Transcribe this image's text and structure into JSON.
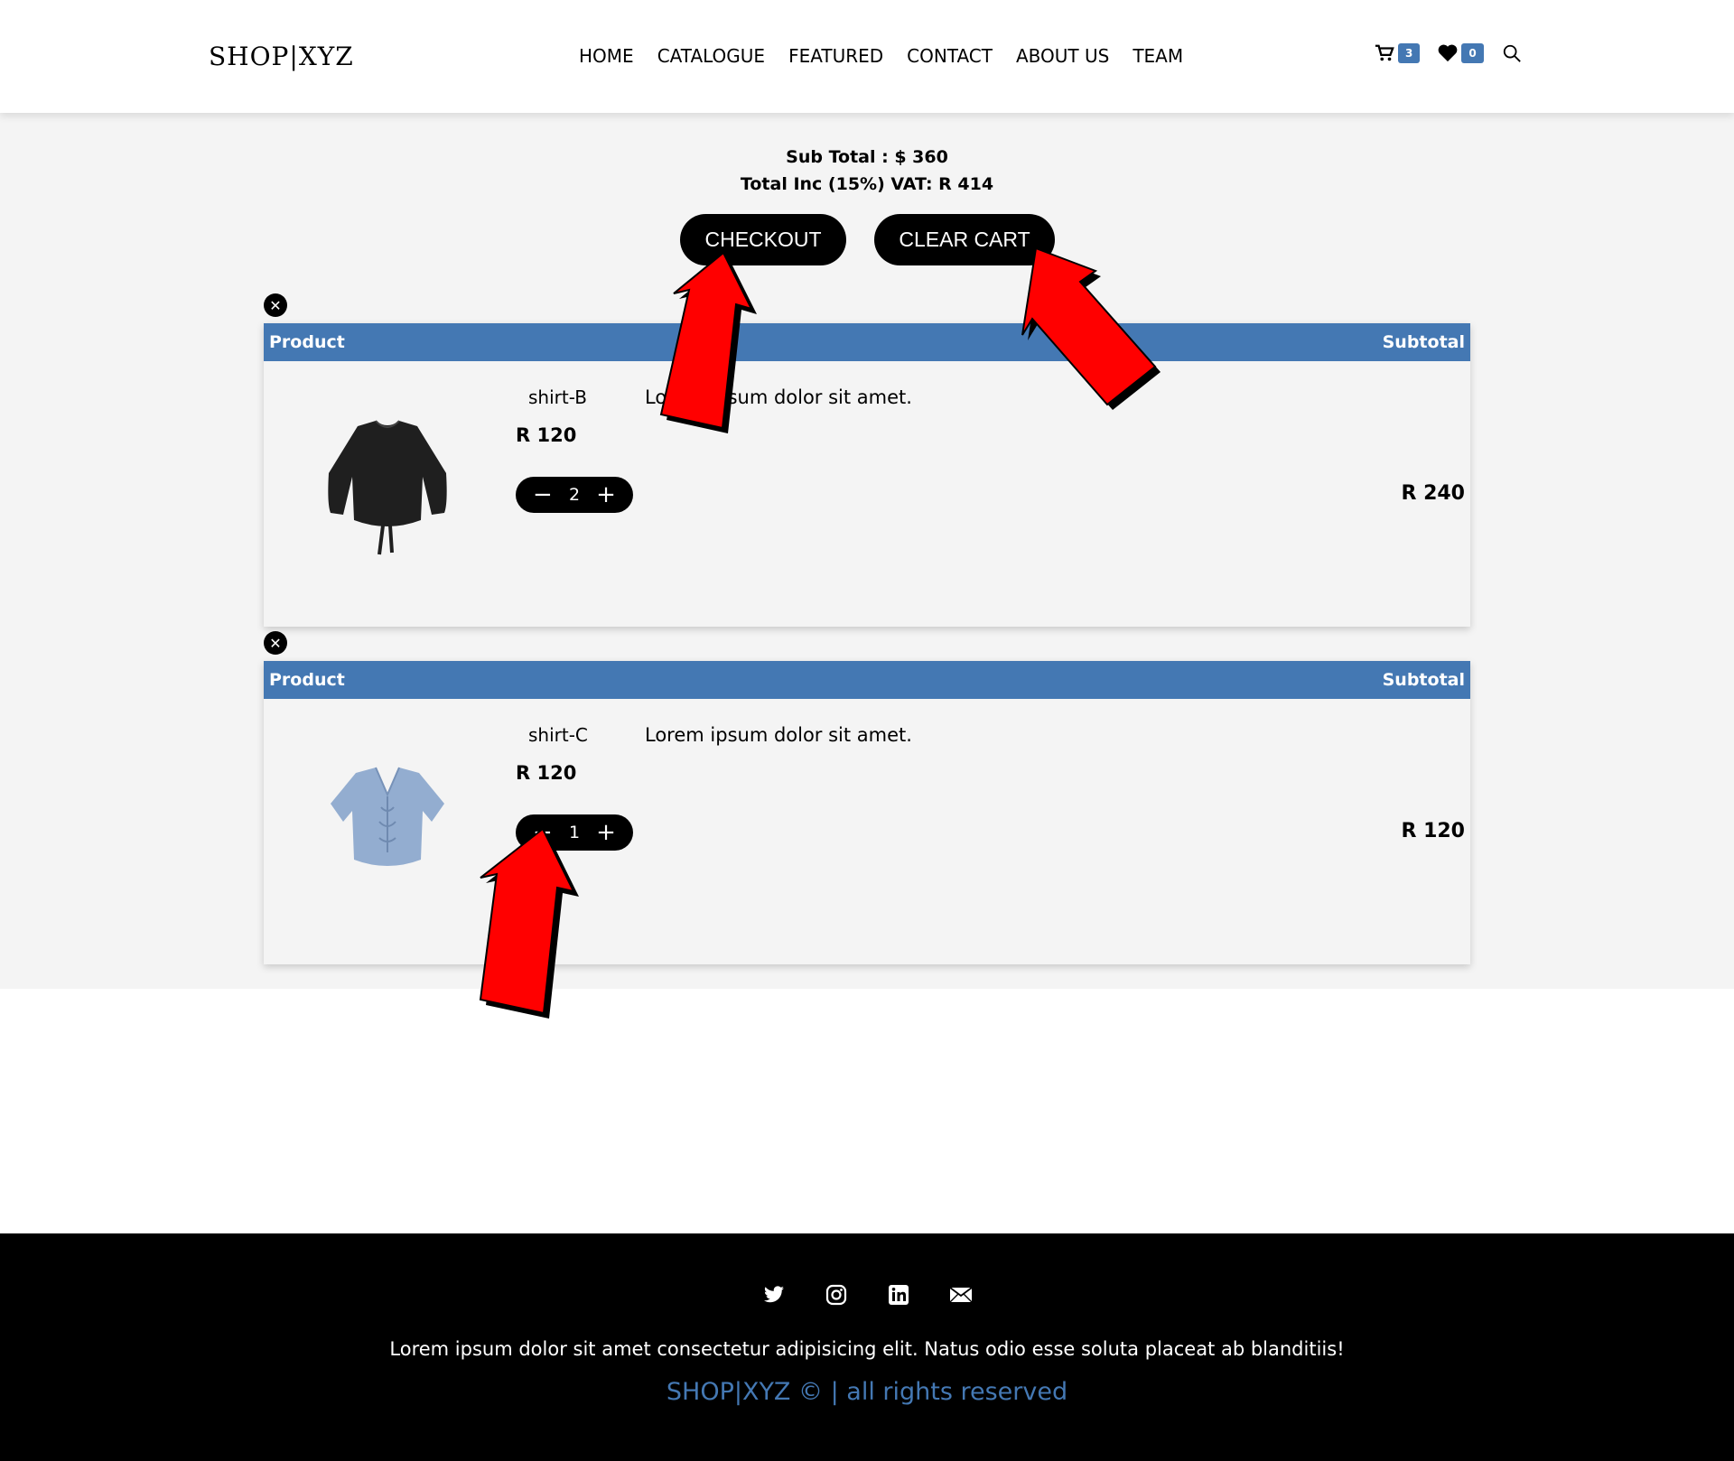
{
  "header": {
    "logo": "SHOP|XYZ",
    "nav": [
      "HOME",
      "CATALOGUE",
      "FEATURED",
      "CONTACT",
      "ABOUT US",
      "TEAM"
    ],
    "cart_count": "3",
    "wishlist_count": "0"
  },
  "summary": {
    "subtotal": "Sub Total : $ 360",
    "total_vat": "Total Inc (15%) VAT: R 414",
    "checkout_label": "CHECKOUT",
    "clear_label": "CLEAR CART"
  },
  "table": {
    "product_header": "Product",
    "subtotal_header": "Subtotal"
  },
  "items": [
    {
      "name": "shirt-B",
      "description": "Lorem ipsum dolor sit amet.",
      "price": "R 120",
      "quantity": "2",
      "subtotal": "R 240",
      "image": "black-shirt"
    },
    {
      "name": "shirt-C",
      "description": "Lorem ipsum dolor sit amet.",
      "price": "R 120",
      "quantity": "1",
      "subtotal": "R 120",
      "image": "blue-shirt"
    }
  ],
  "footer": {
    "text": "Lorem ipsum dolor sit amet consectetur adipisicing elit. Natus odio esse soluta placeat ab blanditiis!",
    "copyright": "SHOP|XYZ © | all rights reserved"
  },
  "colors": {
    "accent": "#4478b3",
    "arrow": "#ff0000"
  },
  "icons": [
    "cart-icon",
    "heart-icon",
    "search-icon",
    "close-icon",
    "minus-icon",
    "plus-icon",
    "twitter-icon",
    "instagram-icon",
    "linkedin-icon",
    "mail-icon"
  ]
}
